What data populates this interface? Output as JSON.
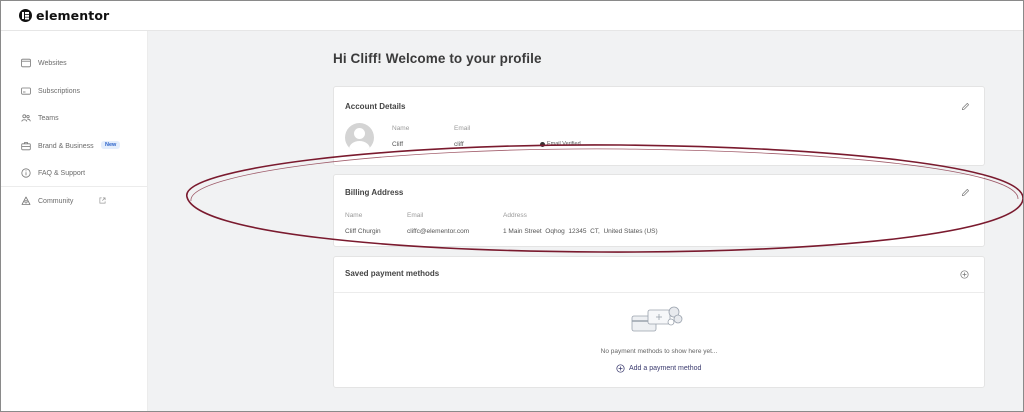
{
  "brand": {
    "name": "elementor"
  },
  "sidebar": {
    "items": [
      {
        "label": "Websites",
        "icon": "browser-window-icon"
      },
      {
        "label": "Subscriptions",
        "icon": "card-icon"
      },
      {
        "label": "Teams",
        "icon": "people-icon"
      },
      {
        "label": "Brand & Business",
        "icon": "briefcase-icon",
        "badge": "New"
      },
      {
        "label": "FAQ & Support",
        "icon": "info-circle-icon"
      },
      {
        "label": "Community",
        "icon": "community-icon",
        "external": true
      }
    ]
  },
  "page": {
    "title": "Hi Cliff! Welcome to your profile"
  },
  "account": {
    "title": "Account Details",
    "name_label": "Name",
    "name_value": "Cliff",
    "email_label": "Email",
    "email_value": "cliff",
    "verified_text": "Email Verified"
  },
  "billing": {
    "title": "Billing Address",
    "name_label": "Name",
    "name_value": "Cliff Churgin",
    "email_label": "Email",
    "email_value": "cliffc@elementor.com",
    "address_label": "Address",
    "address_value": "1 Main Street  Oqhog  12345  CT,  United States (US)"
  },
  "payment": {
    "title": "Saved payment methods",
    "empty_text": "No payment methods to show here yet...",
    "add_label": "Add a payment method"
  },
  "colors": {
    "highlight_oval": "#7a1a2e",
    "badge_bg": "#e4eefc",
    "badge_text": "#2b63c9",
    "main_bg": "#f1f2f3"
  }
}
